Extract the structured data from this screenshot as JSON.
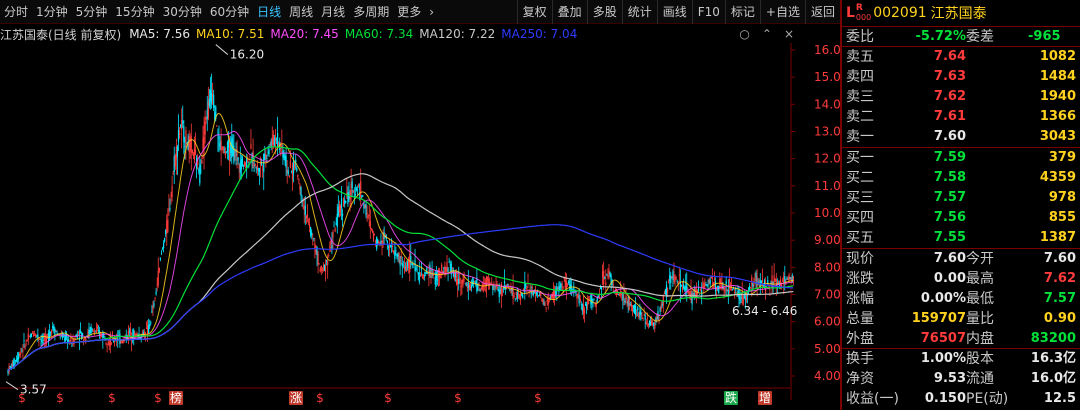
{
  "toolbar": {
    "periods": [
      {
        "id": "fenshi",
        "label": "分时"
      },
      {
        "id": "1min",
        "label": "1分钟"
      },
      {
        "id": "5min",
        "label": "5分钟"
      },
      {
        "id": "15min",
        "label": "15分钟"
      },
      {
        "id": "30min",
        "label": "30分钟"
      },
      {
        "id": "60min",
        "label": "60分钟"
      },
      {
        "id": "day",
        "label": "日线",
        "active": true
      },
      {
        "id": "week",
        "label": "周线"
      },
      {
        "id": "month",
        "label": "月线"
      },
      {
        "id": "multi",
        "label": "多周期"
      },
      {
        "id": "more",
        "label": "更多"
      }
    ],
    "more_arrow": "›",
    "buttons": [
      "复权",
      "叠加",
      "多股",
      "统计",
      "画线",
      "F10",
      "标记",
      "+自选",
      "返回"
    ]
  },
  "header": {
    "title": "江苏国泰(日线 前复权)",
    "ma": [
      {
        "label": "MA5: 7.56",
        "color": "#e8e8e8"
      },
      {
        "label": "MA10: 7.51",
        "color": "#ffd21f"
      },
      {
        "label": "MA20: 7.45",
        "color": "#ff4dff"
      },
      {
        "label": "MA60: 7.34",
        "color": "#00e03a"
      },
      {
        "label": "MA120: 7.22",
        "color": "#c8c8c8"
      },
      {
        "label": "MA250: 7.04",
        "color": "#2d3cff"
      }
    ],
    "icons": [
      "○",
      "⌃",
      "×"
    ]
  },
  "chart_data": {
    "type": "candlestick",
    "y_axis": {
      "min": 4.0,
      "max": 16.0,
      "ticks": [
        "16.00",
        "15.00",
        "14.00",
        "13.00",
        "12.00",
        "11.00",
        "10.00",
        "9.00",
        "8.00",
        "7.00",
        "6.00",
        "5.00",
        "4.00"
      ]
    },
    "annotations": [
      {
        "text": "16.20",
        "value": 16.2
      },
      {
        "text": "3.57",
        "value": 3.57
      },
      {
        "text": "6.34 - 6.46",
        "value": 6.4
      }
    ],
    "markers": [
      "$",
      "$",
      "$",
      "$",
      "榜",
      "涨",
      "$",
      "$",
      "$",
      "$",
      "跌",
      "增"
    ],
    "close_path": [
      4.2,
      4.5,
      4.9,
      5.3,
      5.6,
      5.4,
      5.3,
      5.8,
      5.5,
      5.4,
      5.2,
      5.6,
      5.4,
      5.7,
      5.6,
      5.5,
      5.2,
      5.4,
      5.3,
      5.6,
      5.5,
      5.5,
      5.7,
      6.8,
      8.5,
      9.6,
      11.8,
      13.2,
      12.6,
      12.2,
      11.5,
      13.5,
      14.6,
      12.6,
      12.2,
      12.4,
      12.0,
      11.8,
      12.1,
      11.6,
      11.9,
      12.5,
      12.8,
      12.3,
      11.4,
      11.8,
      10.6,
      9.6,
      8.8,
      7.8,
      8.3,
      9.3,
      10.2,
      10.5,
      10.8,
      11.0,
      10.1,
      9.3,
      8.9,
      9.2,
      8.7,
      8.4,
      8.0,
      8.2,
      7.9,
      7.6,
      7.9,
      7.6,
      7.8,
      8.1,
      7.6,
      7.5,
      7.3,
      7.4,
      7.2,
      7.5,
      7.3,
      7.1,
      7.4,
      7.0,
      6.9,
      7.3,
      7.1,
      7.0,
      6.6,
      6.9,
      7.2,
      7.4,
      7.2,
      7.1,
      6.4,
      6.9,
      6.6,
      7.6,
      7.8,
      7.1,
      6.9,
      6.7,
      6.5,
      6.2,
      6.0,
      5.9,
      6.4,
      7.2,
      7.7,
      7.4,
      7.2,
      6.9,
      7.1,
      7.3,
      7.6,
      7.3,
      7.2,
      7.3,
      7.1,
      6.8,
      7.2,
      7.5,
      7.4,
      7.3,
      7.5,
      7.4,
      7.6
    ],
    "ma_series": [
      {
        "name": "MA5",
        "color": "#e8e8e8"
      },
      {
        "name": "MA10",
        "color": "#ffd21f"
      },
      {
        "name": "MA20",
        "color": "#ff4dff"
      },
      {
        "name": "MA60",
        "color": "#00e03a"
      },
      {
        "name": "MA120",
        "color": "#c8c8c8"
      },
      {
        "name": "MA250",
        "color": "#2d3cff"
      }
    ]
  },
  "quote": {
    "L": "L",
    "R": "R",
    "level": "000",
    "code": "002091",
    "name": "江苏国泰",
    "weibi_label": "委比",
    "weibi_value": "-5.72%",
    "weicha_label": "委差",
    "weicha_value": "-965",
    "asks": [
      {
        "label": "卖五",
        "price": "7.64",
        "vol": "1082"
      },
      {
        "label": "卖四",
        "price": "7.63",
        "vol": "1484"
      },
      {
        "label": "卖三",
        "price": "7.62",
        "vol": "1940"
      },
      {
        "label": "卖二",
        "price": "7.61",
        "vol": "1366"
      },
      {
        "label": "卖一",
        "price": "7.60",
        "vol": "3043"
      }
    ],
    "bids": [
      {
        "label": "买一",
        "price": "7.59",
        "vol": "379"
      },
      {
        "label": "买二",
        "price": "7.58",
        "vol": "4359"
      },
      {
        "label": "买三",
        "price": "7.57",
        "vol": "978"
      },
      {
        "label": "买四",
        "price": "7.56",
        "vol": "855"
      },
      {
        "label": "买五",
        "price": "7.55",
        "vol": "1387"
      }
    ],
    "stats": [
      {
        "l1": "现价",
        "v1": "7.60",
        "c1": "white",
        "l2": "今开",
        "v2": "7.60",
        "c2": "white"
      },
      {
        "l1": "涨跌",
        "v1": "0.00",
        "c1": "white",
        "l2": "最高",
        "v2": "7.62",
        "c2": "red"
      },
      {
        "l1": "涨幅",
        "v1": "0.00%",
        "c1": "white",
        "l2": "最低",
        "v2": "7.57",
        "c2": "green"
      },
      {
        "l1": "总量",
        "v1": "159707",
        "c1": "yellow",
        "l2": "量比",
        "v2": "0.90",
        "c2": "yellow"
      },
      {
        "l1": "外盘",
        "v1": "76507",
        "c1": "red",
        "l2": "内盘",
        "v2": "83200",
        "c2": "green"
      },
      {
        "l1": "换手",
        "v1": "1.00%",
        "c1": "white",
        "l2": "股本",
        "v2": "16.3亿",
        "c2": "white"
      },
      {
        "l1": "净资",
        "v1": "9.53",
        "c1": "white",
        "l2": "流通",
        "v2": "16.0亿",
        "c2": "white"
      },
      {
        "l1": "收益(一)",
        "v1": "0.150",
        "c1": "white",
        "l2": "PE(动)",
        "v2": "12.5",
        "c2": "white"
      }
    ]
  }
}
